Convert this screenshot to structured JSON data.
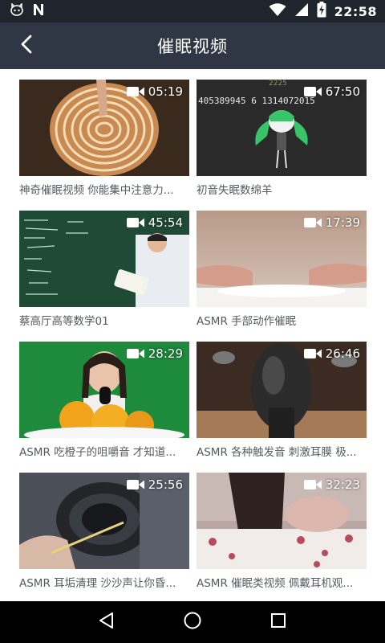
{
  "status_bar": {
    "time": "22:58",
    "icons": [
      "cat-face-icon",
      "n-logo-icon",
      "wifi-icon",
      "signal-icon",
      "battery-charging-icon"
    ]
  },
  "app_bar": {
    "title": "催眠视频",
    "back_icon": "chevron-left-icon"
  },
  "videos": [
    {
      "duration": "05:19",
      "caption": "神奇催眠视频 你能集中注意力..."
    },
    {
      "duration": "67:50",
      "caption": "初音失眠数绵羊"
    },
    {
      "duration": "45:54",
      "caption": "蔡高厅高等数学01"
    },
    {
      "duration": "17:39",
      "caption": "ASMR 手部动作催眠"
    },
    {
      "duration": "28:29",
      "caption": "ASMR 吃橙子的咀嚼音 才知道..."
    },
    {
      "duration": "26:46",
      "caption": "ASMR 各种触发音 刺激耳膜 极..."
    },
    {
      "duration": "25:56",
      "caption": "ASMR 耳垢清理 沙沙声让你昏..."
    },
    {
      "duration": "32:23",
      "caption": "ASMR 催眠类视频 佩戴耳机观..."
    }
  ],
  "thumb_texts": {
    "numbers_line": "405389945 6 1314072015"
  },
  "nav_bar": {
    "icons": [
      "back-triangle-icon",
      "home-circle-icon",
      "recents-square-icon"
    ]
  },
  "colors": {
    "status_bar": "#1e252d",
    "app_bar": "#2e3743",
    "caption_text": "#555a60"
  }
}
